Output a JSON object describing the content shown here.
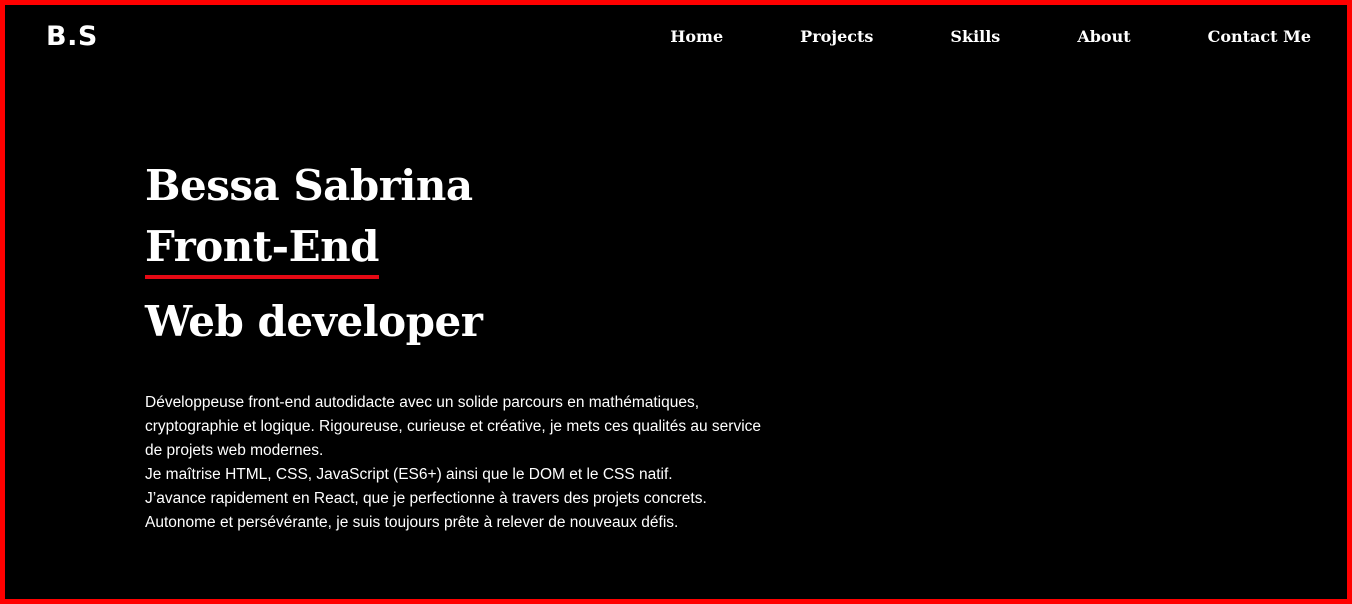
{
  "header": {
    "logo": "B.S",
    "nav": [
      {
        "label": "Home"
      },
      {
        "label": "Projects"
      },
      {
        "label": "Skills"
      },
      {
        "label": "About"
      },
      {
        "label": "Contact Me"
      }
    ]
  },
  "hero": {
    "name": "Bessa Sabrina",
    "role_highlight": "Front-End",
    "role_rest": "Web developer"
  },
  "about": {
    "paragraphs": [
      "Développeuse front-end autodidacte avec un solide parcours en mathématiques, cryptographie et logique. Rigoureuse, curieuse et créative, je mets ces qualités au service de projets web modernes.",
      "Je maîtrise HTML, CSS, JavaScript (ES6+) ainsi que le DOM et le CSS natif.",
      "J’avance rapidement en React, que je perfectionne à travers des projets concrets.",
      "Autonome et persévérante, je suis toujours prête à relever de nouveaux défis."
    ]
  },
  "colors": {
    "background": "#000000",
    "border": "#ff0000",
    "underline": "#e50914",
    "text": "#ffffff"
  }
}
